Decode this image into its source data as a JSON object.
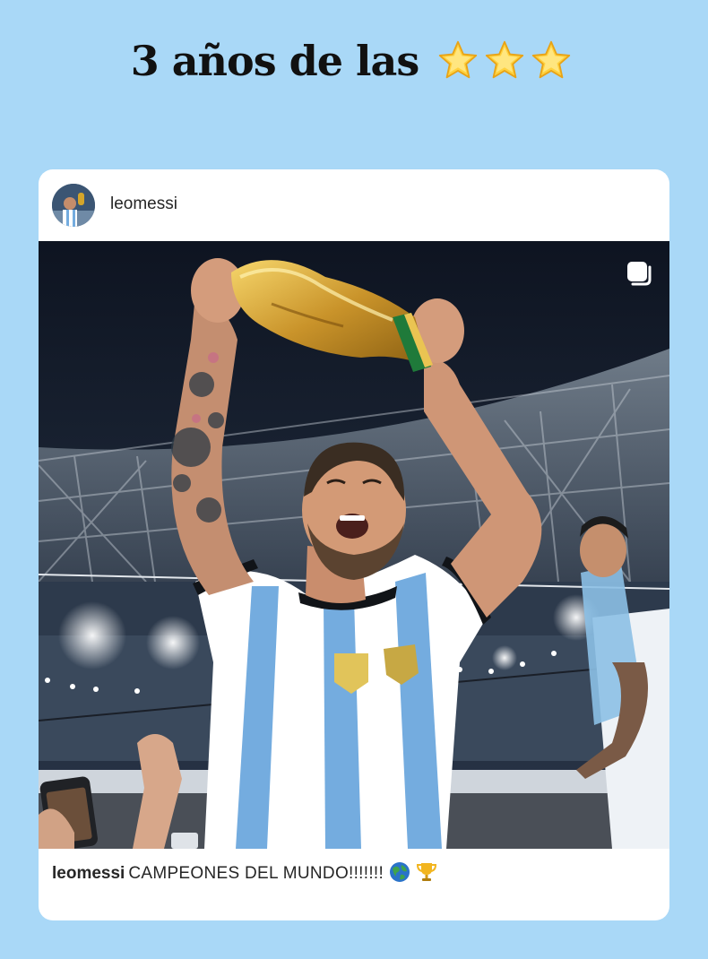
{
  "headline": {
    "text": "3 años de las",
    "emoji": "three-star-emojis"
  },
  "post": {
    "username": "leomessi",
    "avatar_icon": "profile-photo",
    "carousel_icon": "multiple-photos-icon",
    "photo": {
      "subject": "player-lifting-trophy"
    },
    "caption": {
      "username": "leomessi",
      "text": "CAMPEONES DEL MUNDO!!!!!!!",
      "emojis": [
        "globe-icon",
        "trophy-icon"
      ]
    }
  },
  "colors": {
    "page_background": "#a9d8f7",
    "card_background": "#ffffff",
    "text_dark": "#262626",
    "headline_text": "#111111",
    "argentina_sky_blue": "#74acdf",
    "gold": "#d4a52a"
  }
}
